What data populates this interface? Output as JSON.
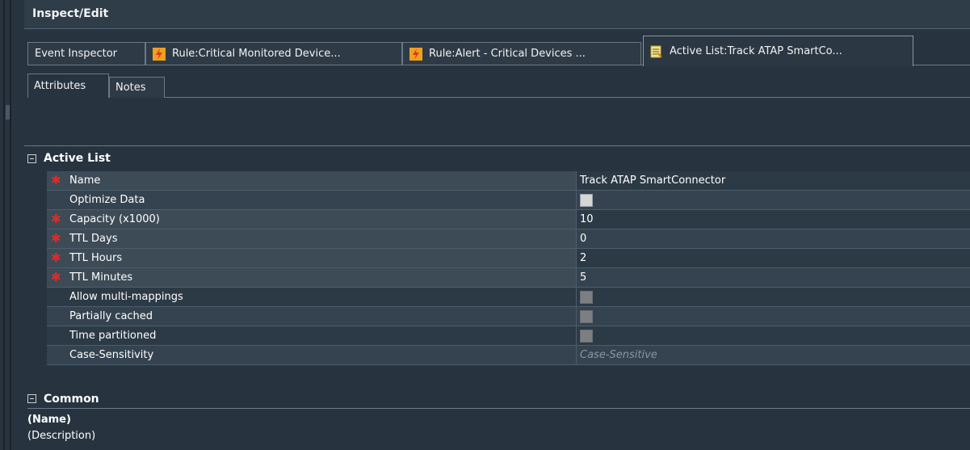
{
  "panel": {
    "title": "Inspect/Edit"
  },
  "tabs": [
    {
      "label": "Event Inspector",
      "icon": ""
    },
    {
      "label": "Rule:Critical Monitored Device...",
      "icon": "rule-lightning-icon"
    },
    {
      "label": "Rule:Alert - Critical Devices ...",
      "icon": "rule-lightning-icon"
    },
    {
      "label": "Active List:Track ATAP SmartCo...",
      "icon": "active-list-icon"
    }
  ],
  "subtabs": [
    {
      "label": "Attributes"
    },
    {
      "label": "Notes"
    }
  ],
  "sections": {
    "active_list": {
      "label": "Active List"
    },
    "common": {
      "label": "Common",
      "name_label": "(Name)",
      "description_label": "(Description)"
    }
  },
  "properties": [
    {
      "name": "Name",
      "required": true,
      "value": "Track ATAP SmartConnector",
      "type": "text"
    },
    {
      "name": "Optimize Data",
      "required": false,
      "value": "",
      "type": "checkbox",
      "state": "unchecked"
    },
    {
      "name": "Capacity (x1000)",
      "required": true,
      "value": "10",
      "type": "text"
    },
    {
      "name": "TTL Days",
      "required": true,
      "value": "0",
      "type": "text"
    },
    {
      "name": "TTL Hours",
      "required": true,
      "value": "2",
      "type": "text"
    },
    {
      "name": "TTL Minutes",
      "required": true,
      "value": "5",
      "type": "text"
    },
    {
      "name": "Allow multi-mappings",
      "required": false,
      "value": "",
      "type": "checkbox",
      "state": "disabled"
    },
    {
      "name": "Partially cached",
      "required": false,
      "value": "",
      "type": "checkbox",
      "state": "disabled"
    },
    {
      "name": "Time partitioned",
      "required": false,
      "value": "",
      "type": "checkbox",
      "state": "disabled"
    },
    {
      "name": "Case-Sensitivity",
      "required": false,
      "value": "Case-Sensitive",
      "type": "readonly"
    }
  ],
  "colors": {
    "background": "#273440",
    "required_marker": "#e02a2a",
    "grid_line": "#4e5d6b"
  }
}
